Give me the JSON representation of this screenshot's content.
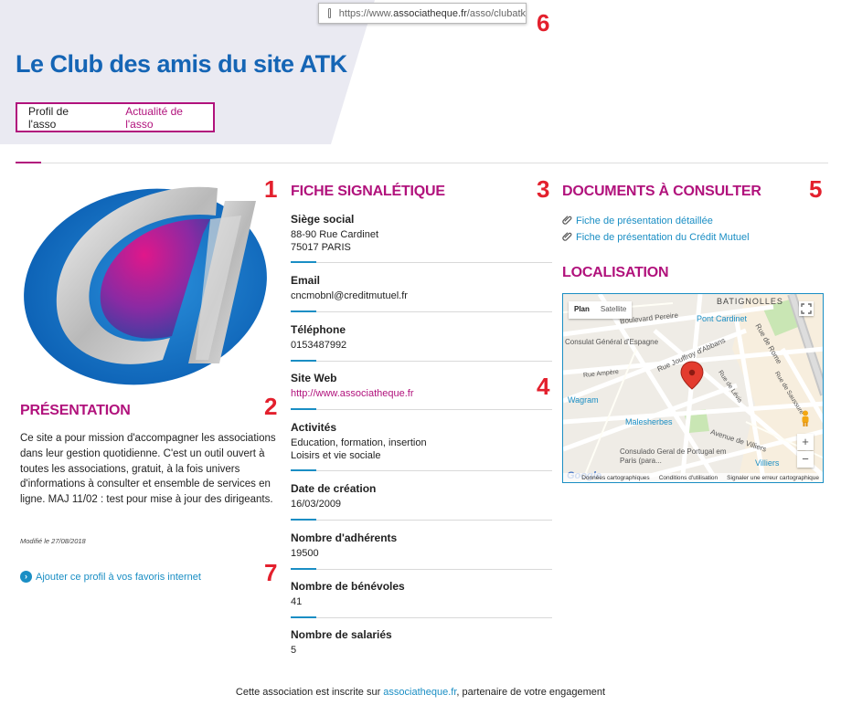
{
  "browser": {
    "url_prefix": "https://www.",
    "url_domain": "associatheque.fr",
    "url_path": "/asso/clubatk"
  },
  "header": {
    "title": "Le Club des amis du site ATK"
  },
  "tabs": [
    {
      "label": "Profil de l'asso"
    },
    {
      "label": "Actualité de l'asso"
    }
  ],
  "annotations": [
    "1",
    "2",
    "3",
    "4",
    "5",
    "6",
    "7"
  ],
  "presentation": {
    "title": "PRÉSENTATION",
    "text": "Ce site a pour mission d'accompagner les associations dans leur gestion quotidienne. C'est un outil ouvert à toutes les associations, gratuit, à la fois univers d'informations à consulter et ensemble de services en ligne. MAJ 11/02 : test pour mise à jour des dirigeants.",
    "modified": "Modifié le 27/08/2018",
    "favorites_link": "Ajouter ce profil à vos favoris internet"
  },
  "fiche": {
    "title": "FICHE SIGNALÉTIQUE",
    "items": [
      {
        "label": "Siège social",
        "lines": [
          "88-90 Rue Cardinet",
          "75017 PARIS"
        ]
      },
      {
        "label": "Email",
        "lines": [
          "cncmobnl@creditmutuel.fr"
        ]
      },
      {
        "label": "Téléphone",
        "lines": [
          "0153487992"
        ]
      },
      {
        "label": "Site Web",
        "lines": [
          "http://www.associatheque.fr"
        ]
      },
      {
        "label": "Activités",
        "lines": [
          "Education, formation, insertion",
          "Loisirs et vie sociale"
        ]
      },
      {
        "label": "Date de création",
        "lines": [
          "16/03/2009"
        ]
      },
      {
        "label": "Nombre d'adhérents",
        "lines": [
          "19500"
        ]
      },
      {
        "label": "Nombre de bénévoles",
        "lines": [
          "41"
        ]
      },
      {
        "label": "Nombre de salariés",
        "lines": [
          "5"
        ]
      }
    ]
  },
  "documents": {
    "title": "DOCUMENTS À CONSULTER",
    "items": [
      {
        "label": "Fiche de présentation détaillée"
      },
      {
        "label": "Fiche de présentation du Crédit Mutuel"
      }
    ]
  },
  "localisation": {
    "title": "LOCALISATION",
    "map": {
      "tab_plan": "Plan",
      "tab_satellite": "Satellite",
      "zoom_in": "+",
      "zoom_out": "−",
      "google": "Google",
      "footer_data": "Données cartographiques",
      "footer_terms": "Conditions d'utilisation",
      "footer_report": "Signaler une erreur cartographique",
      "labels": [
        "BATIGNOLLES",
        "Boulevard Pereire",
        "Pont Cardinet",
        "Consulat Général d'Espagne",
        "Rue Jouffroy d'Abbans",
        "Rue de Rome",
        "Rue Ampère",
        "Wagram",
        "Rue de Lévis",
        "Rue de Saussure",
        "Malesherbes",
        "Avenue de Villiers",
        "Consulado Geral de Portugal em Paris (para...",
        "Villiers"
      ]
    }
  },
  "footer": {
    "prefix": "Cette association est inscrite sur ",
    "link": "associatheque.fr",
    "suffix": ", partenaire de votre engagement"
  },
  "colors": {
    "brand_blue": "#1565b5",
    "accent_magenta": "#b1127c",
    "link_blue": "#1a8ec4",
    "annotation_red": "#e3202d",
    "hero_bg": "#eaeaf2"
  }
}
